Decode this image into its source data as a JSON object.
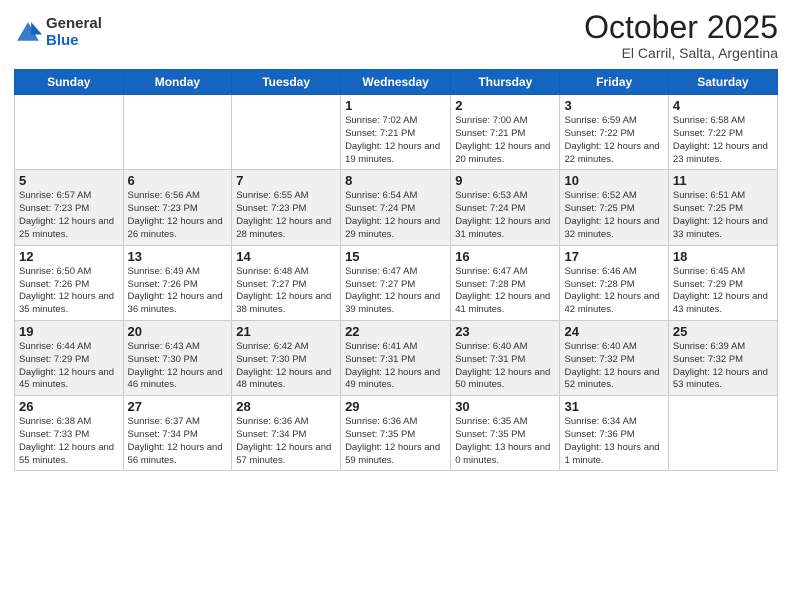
{
  "header": {
    "logo_general": "General",
    "logo_blue": "Blue",
    "title": "October 2025",
    "subtitle": "El Carril, Salta, Argentina"
  },
  "weekdays": [
    "Sunday",
    "Monday",
    "Tuesday",
    "Wednesday",
    "Thursday",
    "Friday",
    "Saturday"
  ],
  "weeks": [
    [
      {
        "day": "",
        "sunrise": "",
        "sunset": "",
        "daylight": ""
      },
      {
        "day": "",
        "sunrise": "",
        "sunset": "",
        "daylight": ""
      },
      {
        "day": "",
        "sunrise": "",
        "sunset": "",
        "daylight": ""
      },
      {
        "day": "1",
        "sunrise": "Sunrise: 7:02 AM",
        "sunset": "Sunset: 7:21 PM",
        "daylight": "Daylight: 12 hours and 19 minutes."
      },
      {
        "day": "2",
        "sunrise": "Sunrise: 7:00 AM",
        "sunset": "Sunset: 7:21 PM",
        "daylight": "Daylight: 12 hours and 20 minutes."
      },
      {
        "day": "3",
        "sunrise": "Sunrise: 6:59 AM",
        "sunset": "Sunset: 7:22 PM",
        "daylight": "Daylight: 12 hours and 22 minutes."
      },
      {
        "day": "4",
        "sunrise": "Sunrise: 6:58 AM",
        "sunset": "Sunset: 7:22 PM",
        "daylight": "Daylight: 12 hours and 23 minutes."
      }
    ],
    [
      {
        "day": "5",
        "sunrise": "Sunrise: 6:57 AM",
        "sunset": "Sunset: 7:23 PM",
        "daylight": "Daylight: 12 hours and 25 minutes."
      },
      {
        "day": "6",
        "sunrise": "Sunrise: 6:56 AM",
        "sunset": "Sunset: 7:23 PM",
        "daylight": "Daylight: 12 hours and 26 minutes."
      },
      {
        "day": "7",
        "sunrise": "Sunrise: 6:55 AM",
        "sunset": "Sunset: 7:23 PM",
        "daylight": "Daylight: 12 hours and 28 minutes."
      },
      {
        "day": "8",
        "sunrise": "Sunrise: 6:54 AM",
        "sunset": "Sunset: 7:24 PM",
        "daylight": "Daylight: 12 hours and 29 minutes."
      },
      {
        "day": "9",
        "sunrise": "Sunrise: 6:53 AM",
        "sunset": "Sunset: 7:24 PM",
        "daylight": "Daylight: 12 hours and 31 minutes."
      },
      {
        "day": "10",
        "sunrise": "Sunrise: 6:52 AM",
        "sunset": "Sunset: 7:25 PM",
        "daylight": "Daylight: 12 hours and 32 minutes."
      },
      {
        "day": "11",
        "sunrise": "Sunrise: 6:51 AM",
        "sunset": "Sunset: 7:25 PM",
        "daylight": "Daylight: 12 hours and 33 minutes."
      }
    ],
    [
      {
        "day": "12",
        "sunrise": "Sunrise: 6:50 AM",
        "sunset": "Sunset: 7:26 PM",
        "daylight": "Daylight: 12 hours and 35 minutes."
      },
      {
        "day": "13",
        "sunrise": "Sunrise: 6:49 AM",
        "sunset": "Sunset: 7:26 PM",
        "daylight": "Daylight: 12 hours and 36 minutes."
      },
      {
        "day": "14",
        "sunrise": "Sunrise: 6:48 AM",
        "sunset": "Sunset: 7:27 PM",
        "daylight": "Daylight: 12 hours and 38 minutes."
      },
      {
        "day": "15",
        "sunrise": "Sunrise: 6:47 AM",
        "sunset": "Sunset: 7:27 PM",
        "daylight": "Daylight: 12 hours and 39 minutes."
      },
      {
        "day": "16",
        "sunrise": "Sunrise: 6:47 AM",
        "sunset": "Sunset: 7:28 PM",
        "daylight": "Daylight: 12 hours and 41 minutes."
      },
      {
        "day": "17",
        "sunrise": "Sunrise: 6:46 AM",
        "sunset": "Sunset: 7:28 PM",
        "daylight": "Daylight: 12 hours and 42 minutes."
      },
      {
        "day": "18",
        "sunrise": "Sunrise: 6:45 AM",
        "sunset": "Sunset: 7:29 PM",
        "daylight": "Daylight: 12 hours and 43 minutes."
      }
    ],
    [
      {
        "day": "19",
        "sunrise": "Sunrise: 6:44 AM",
        "sunset": "Sunset: 7:29 PM",
        "daylight": "Daylight: 12 hours and 45 minutes."
      },
      {
        "day": "20",
        "sunrise": "Sunrise: 6:43 AM",
        "sunset": "Sunset: 7:30 PM",
        "daylight": "Daylight: 12 hours and 46 minutes."
      },
      {
        "day": "21",
        "sunrise": "Sunrise: 6:42 AM",
        "sunset": "Sunset: 7:30 PM",
        "daylight": "Daylight: 12 hours and 48 minutes."
      },
      {
        "day": "22",
        "sunrise": "Sunrise: 6:41 AM",
        "sunset": "Sunset: 7:31 PM",
        "daylight": "Daylight: 12 hours and 49 minutes."
      },
      {
        "day": "23",
        "sunrise": "Sunrise: 6:40 AM",
        "sunset": "Sunset: 7:31 PM",
        "daylight": "Daylight: 12 hours and 50 minutes."
      },
      {
        "day": "24",
        "sunrise": "Sunrise: 6:40 AM",
        "sunset": "Sunset: 7:32 PM",
        "daylight": "Daylight: 12 hours and 52 minutes."
      },
      {
        "day": "25",
        "sunrise": "Sunrise: 6:39 AM",
        "sunset": "Sunset: 7:32 PM",
        "daylight": "Daylight: 12 hours and 53 minutes."
      }
    ],
    [
      {
        "day": "26",
        "sunrise": "Sunrise: 6:38 AM",
        "sunset": "Sunset: 7:33 PM",
        "daylight": "Daylight: 12 hours and 55 minutes."
      },
      {
        "day": "27",
        "sunrise": "Sunrise: 6:37 AM",
        "sunset": "Sunset: 7:34 PM",
        "daylight": "Daylight: 12 hours and 56 minutes."
      },
      {
        "day": "28",
        "sunrise": "Sunrise: 6:36 AM",
        "sunset": "Sunset: 7:34 PM",
        "daylight": "Daylight: 12 hours and 57 minutes."
      },
      {
        "day": "29",
        "sunrise": "Sunrise: 6:36 AM",
        "sunset": "Sunset: 7:35 PM",
        "daylight": "Daylight: 12 hours and 59 minutes."
      },
      {
        "day": "30",
        "sunrise": "Sunrise: 6:35 AM",
        "sunset": "Sunset: 7:35 PM",
        "daylight": "Daylight: 13 hours and 0 minutes."
      },
      {
        "day": "31",
        "sunrise": "Sunrise: 6:34 AM",
        "sunset": "Sunset: 7:36 PM",
        "daylight": "Daylight: 13 hours and 1 minute."
      },
      {
        "day": "",
        "sunrise": "",
        "sunset": "",
        "daylight": ""
      }
    ]
  ]
}
